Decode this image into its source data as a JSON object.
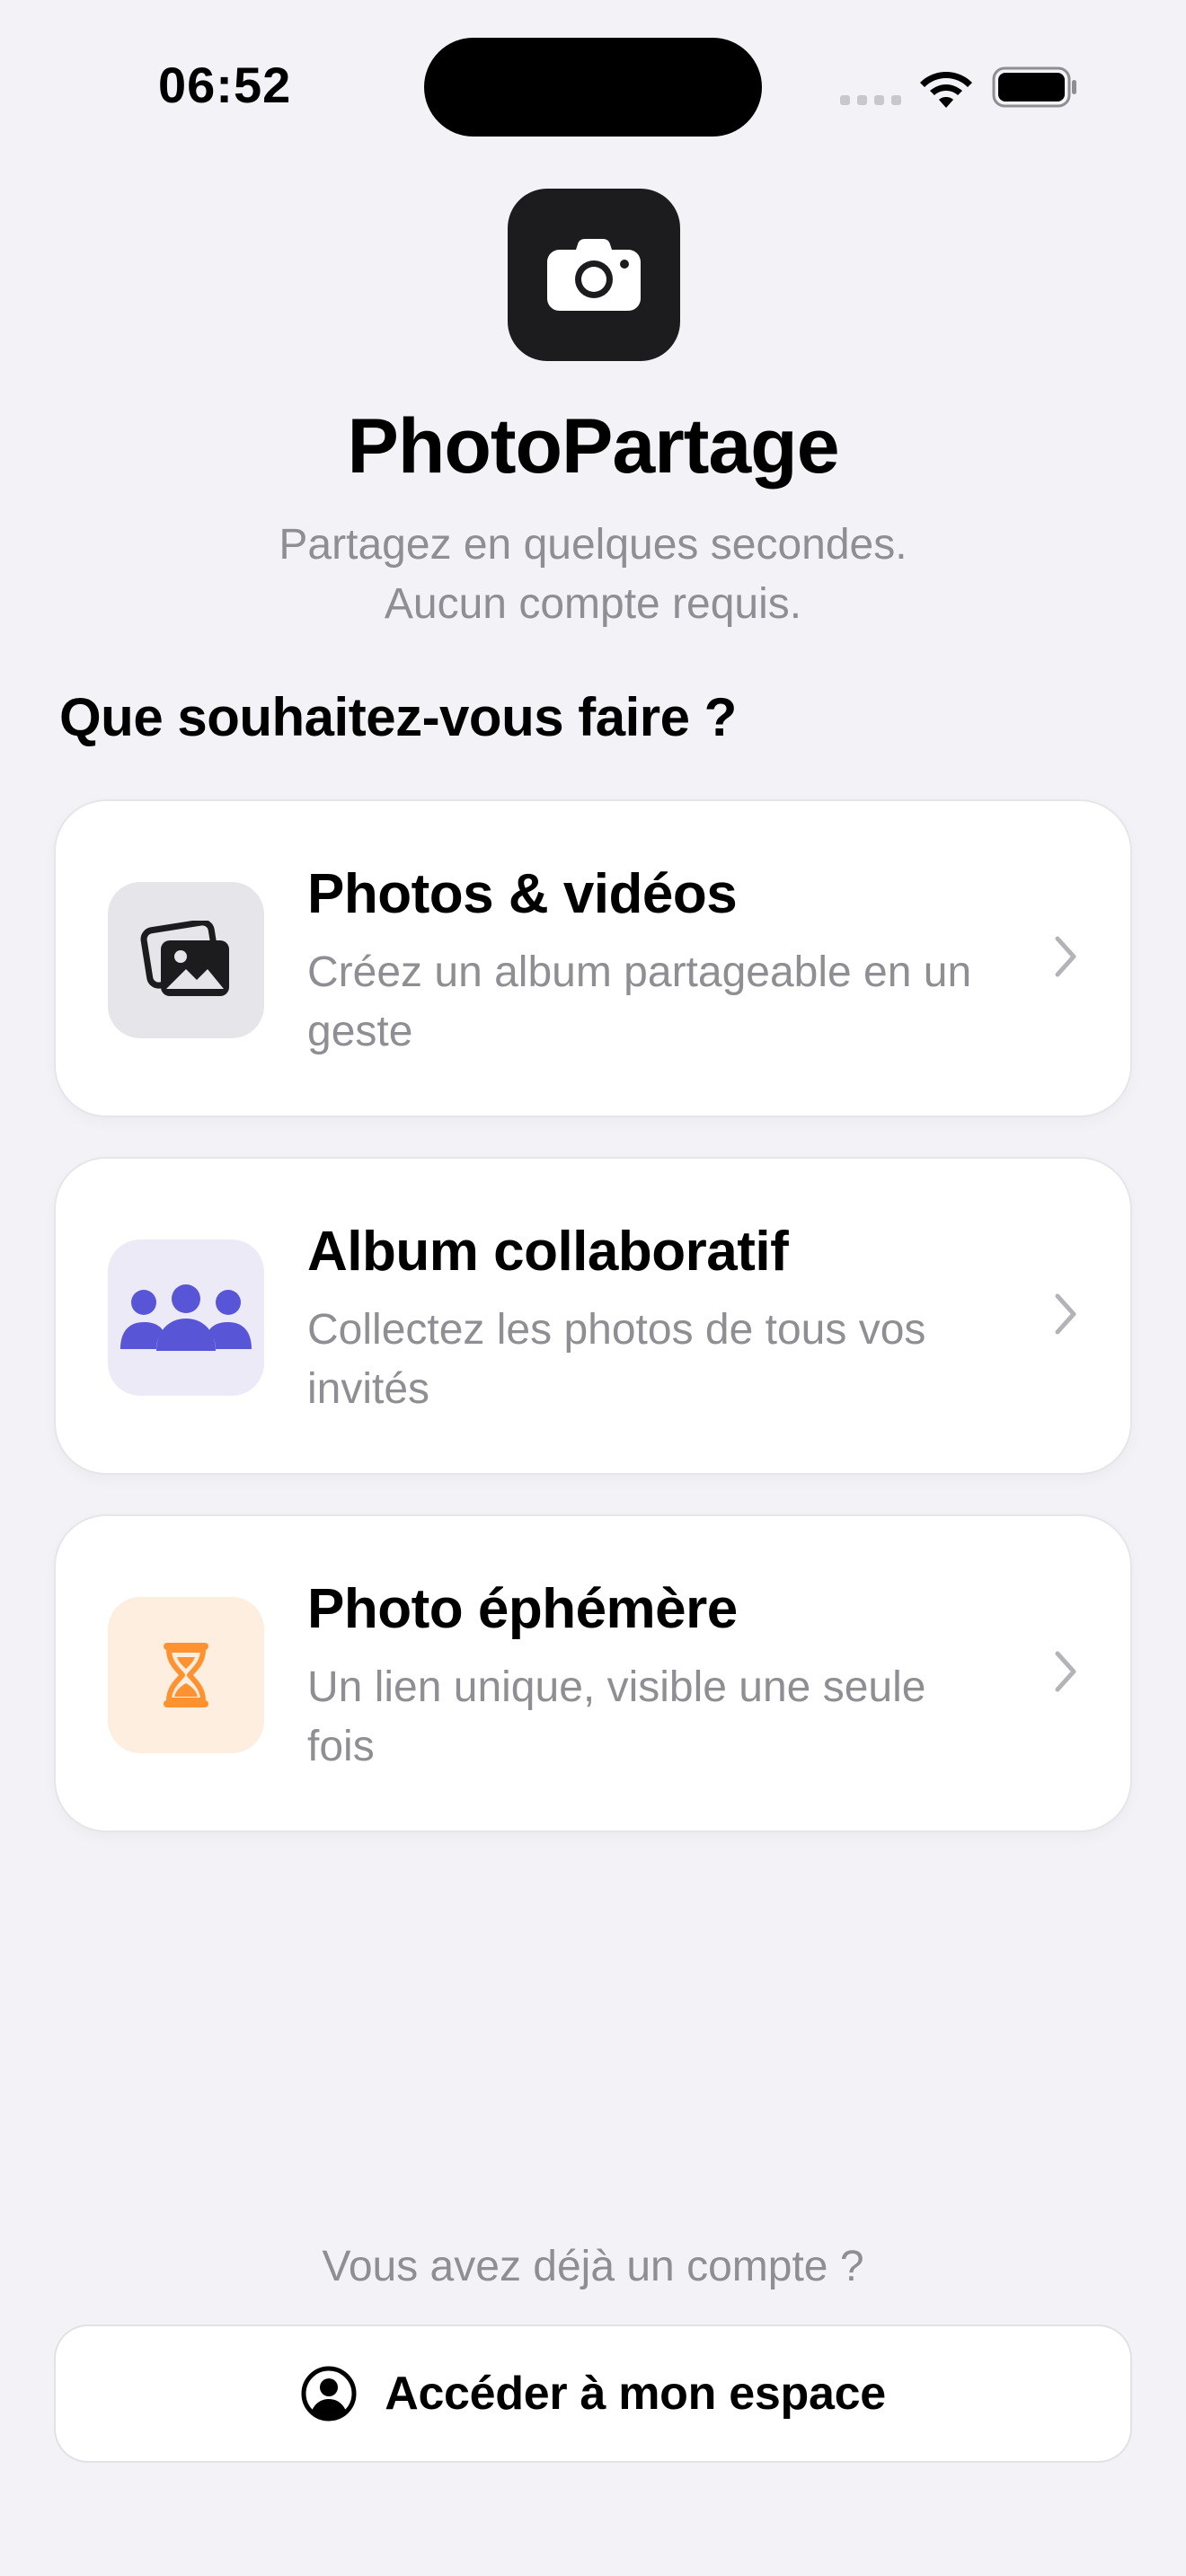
{
  "status_bar": {
    "time": "06:52",
    "icons": [
      "signal-icon",
      "wifi-icon",
      "battery-icon"
    ]
  },
  "header": {
    "app_icon": "camera-icon",
    "title": "PhotoPartage",
    "subtitle_line1": "Partagez en quelques secondes.",
    "subtitle_line2": "Aucun compte requis."
  },
  "main": {
    "heading": "Que souhaitez-vous faire ?",
    "options": [
      {
        "icon": "photos-stack-icon",
        "title": "Photos & vidéos",
        "description": "Créez un album partageable en un geste",
        "accent": "#1c1c1e"
      },
      {
        "icon": "group-people-icon",
        "title": "Album collaboratif",
        "description": "Collectez les photos de tous vos invités",
        "accent": "#5856d6"
      },
      {
        "icon": "hourglass-icon",
        "title": "Photo éphémère",
        "description": "Un lien unique, visible une seule fois",
        "accent": "#ff9230"
      }
    ]
  },
  "footer": {
    "question": "Vous avez déjà un compte ?",
    "button_label": "Accéder à mon espace",
    "button_icon": "person-circle-icon"
  },
  "colors": {
    "background": "#f2f2f7",
    "secondary_text": "#8e8e93",
    "chevron": "#c7c7cc"
  }
}
